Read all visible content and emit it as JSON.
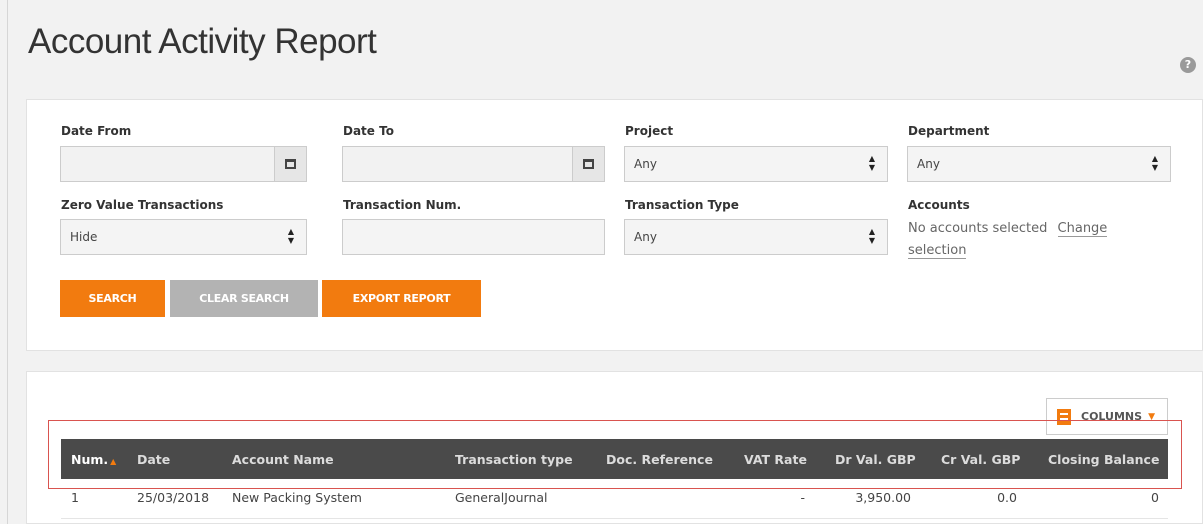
{
  "page": {
    "title": "Account Activity Report",
    "help_icon": "?"
  },
  "filters": {
    "date_from": {
      "label": "Date From",
      "value": ""
    },
    "date_to": {
      "label": "Date To",
      "value": ""
    },
    "project": {
      "label": "Project",
      "value": "Any"
    },
    "department": {
      "label": "Department",
      "value": "Any"
    },
    "zero_value": {
      "label": "Zero Value Transactions",
      "value": "Hide"
    },
    "transaction_num": {
      "label": "Transaction Num.",
      "value": ""
    },
    "transaction_type": {
      "label": "Transaction Type",
      "value": "Any"
    },
    "accounts": {
      "label": "Accounts",
      "none_text": "No accounts selected",
      "change_link": "Change",
      "change_link_2": "selection"
    }
  },
  "buttons": {
    "search": "SEARCH",
    "clear": "CLEAR SEARCH",
    "export": "EXPORT REPORT",
    "columns": "COLUMNS"
  },
  "table": {
    "headers": [
      "Num.",
      "Date",
      "Account Name",
      "Transaction type",
      "Doc. Reference",
      "VAT Rate",
      "Dr Val. GBP",
      "Cr Val. GBP",
      "Closing Balance"
    ],
    "rows": [
      [
        "1",
        "25/03/2018",
        "New Packing System",
        "GeneralJournal",
        "",
        "-",
        "3,950.00",
        "0.0",
        "0"
      ]
    ]
  },
  "colors": {
    "accent": "#f27b0f",
    "header_bg": "#4a4a4a",
    "highlight": "#d9534f"
  }
}
